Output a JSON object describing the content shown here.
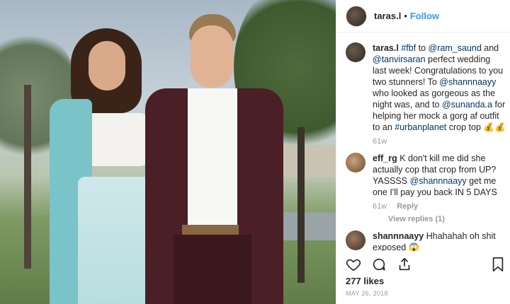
{
  "post": {
    "username": "taras.l",
    "follow_label": "Follow",
    "separator": "•",
    "likes": "277 likes",
    "date": "MAY 26, 2018"
  },
  "comments": [
    {
      "username": "taras.l",
      "parts": [
        {
          "t": "taras.l",
          "type": "user"
        },
        {
          "t": " #fbf",
          "type": "mention"
        },
        {
          "t": " to ",
          "type": "text"
        },
        {
          "t": "@ram_saund",
          "type": "mention"
        },
        {
          "t": " and ",
          "type": "text"
        },
        {
          "t": "@tanvirsaran",
          "type": "mention"
        },
        {
          "t": " perfect wedding last week! Congratulations to you two stunners! To ",
          "type": "text"
        },
        {
          "t": "@shannnaayy",
          "type": "mention"
        },
        {
          "t": " who looked as gorgeous as the night was, and to ",
          "type": "text"
        },
        {
          "t": "@sunanda.a",
          "type": "mention"
        },
        {
          "t": " for helping her mock a gorg af outfit to an ",
          "type": "text"
        },
        {
          "t": "#urbanplanet",
          "type": "mention"
        },
        {
          "t": " crop top 💰💰",
          "type": "text"
        }
      ],
      "time": "61w"
    },
    {
      "username": "eff_rg",
      "parts": [
        {
          "t": "eff_rg",
          "type": "user"
        },
        {
          "t": " K don't kill me did she actually cop that crop from UP? YASSSS ",
          "type": "text"
        },
        {
          "t": "@shannnaayy",
          "type": "mention"
        },
        {
          "t": " get me one I'll pay you back IN 5 DAYS",
          "type": "text"
        }
      ],
      "time": "61w",
      "reply": "Reply",
      "view_replies": "View replies (1)"
    },
    {
      "username": "shannnaayy",
      "parts": [
        {
          "t": "shannnaayy",
          "type": "user"
        },
        {
          "t": " Hhahahah oh shit exposed 😱",
          "type": "text"
        }
      ]
    }
  ],
  "icons": [
    "heart-icon",
    "comment-icon",
    "share-icon",
    "bookmark-icon"
  ]
}
